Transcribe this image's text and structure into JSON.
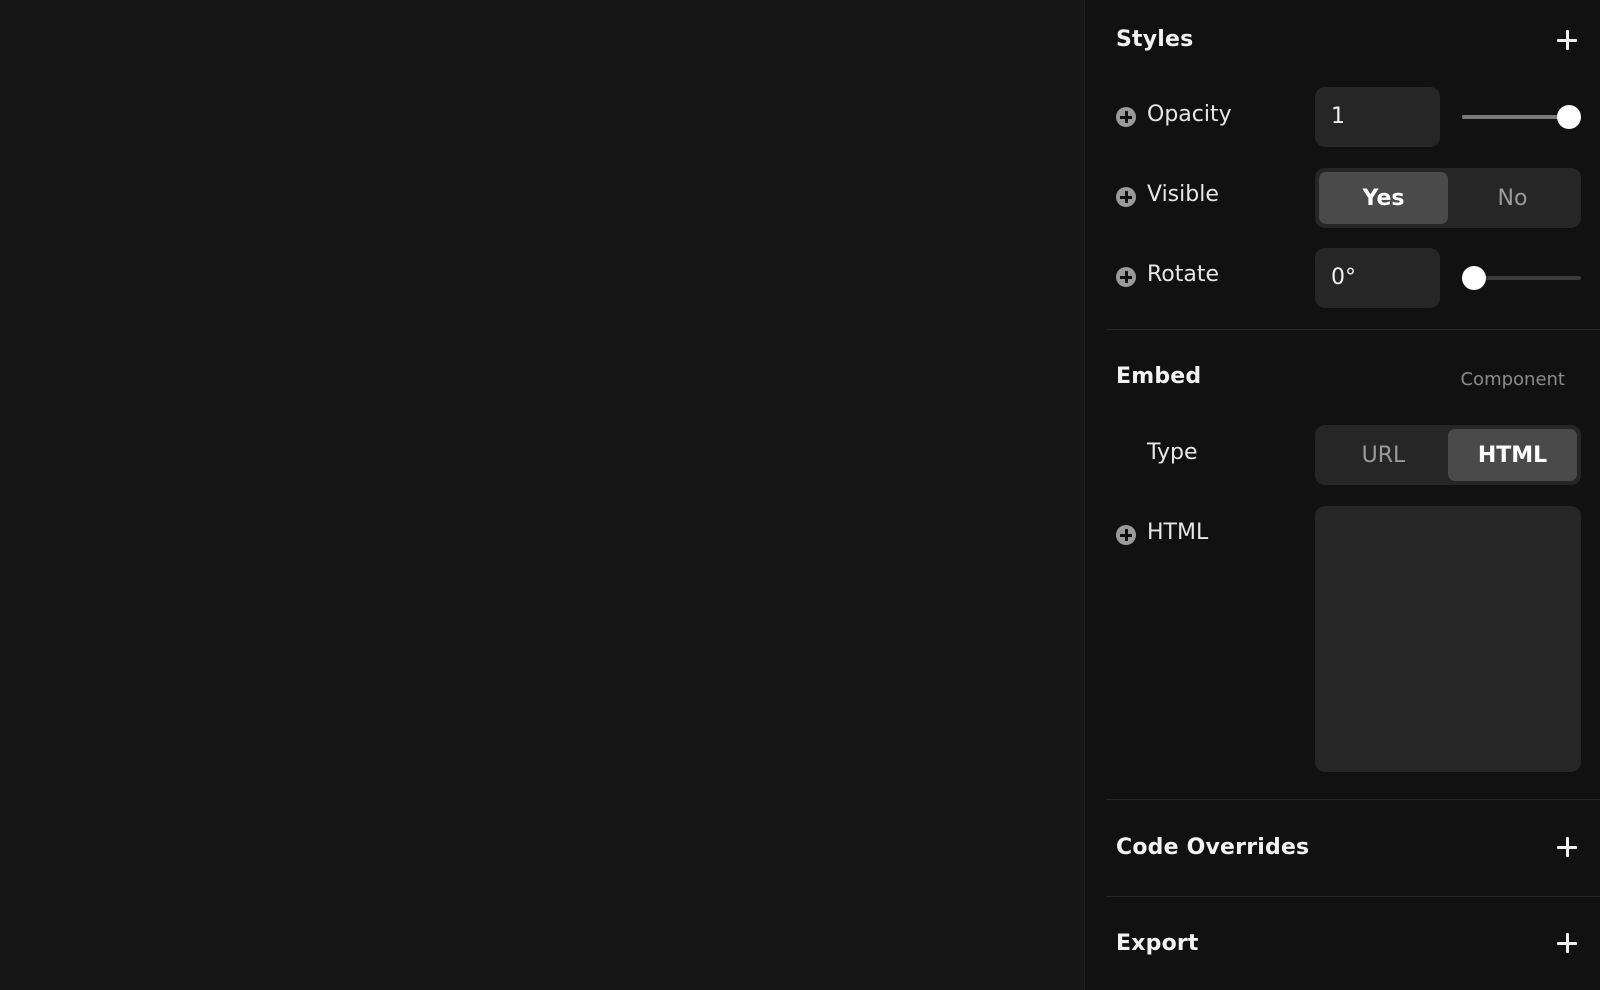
{
  "styles": {
    "title": "Styles",
    "opacity": {
      "label": "Opacity",
      "value": "1",
      "slider_fraction": 1.0
    },
    "visible": {
      "label": "Visible",
      "options": [
        "Yes",
        "No"
      ],
      "selected": "Yes"
    },
    "rotate": {
      "label": "Rotate",
      "value": "0°",
      "slider_fraction": 0.0
    }
  },
  "embed": {
    "title": "Embed",
    "subtitle": "Component",
    "type": {
      "label": "Type",
      "options": [
        "URL",
        "HTML"
      ],
      "selected": "HTML"
    },
    "html": {
      "label": "HTML",
      "value": ""
    }
  },
  "code_overrides": {
    "title": "Code Overrides"
  },
  "export": {
    "title": "Export"
  },
  "icons": {
    "add": "plus-icon",
    "row_add": "plus-circle-icon"
  },
  "colors": {
    "canvas_bg": "#171717",
    "panel_bg": "#111111",
    "control_bg": "#262626",
    "segment_active_bg": "#4a4a4a"
  }
}
